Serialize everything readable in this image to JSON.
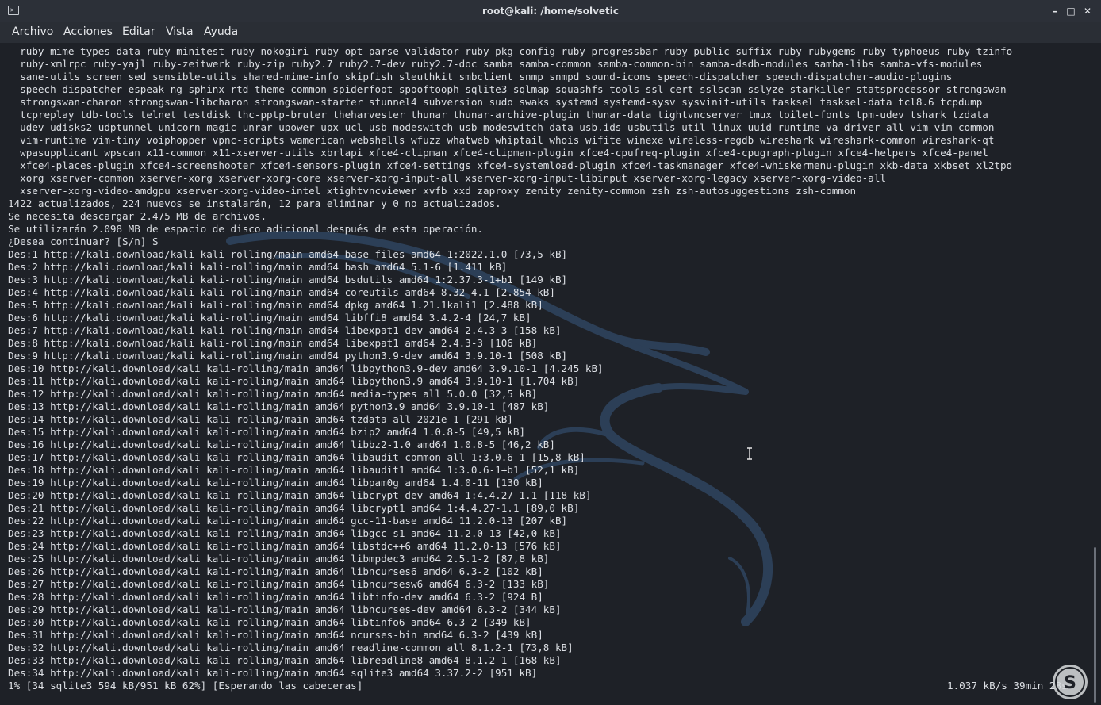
{
  "window": {
    "title": "root@kali: /home/solvetic",
    "icon": "terminal-icon",
    "controls": {
      "minimize": "minimize-icon",
      "maximize": "maximize-icon",
      "close": "close-icon"
    }
  },
  "menubar": {
    "items": [
      "Archivo",
      "Acciones",
      "Editar",
      "Vista",
      "Ayuda"
    ]
  },
  "terminal": {
    "lines": [
      "  ruby-mime-types-data ruby-minitest ruby-nokogiri ruby-opt-parse-validator ruby-pkg-config ruby-progressbar ruby-public-suffix ruby-rubygems ruby-typhoeus ruby-tzinfo",
      "  ruby-xmlrpc ruby-yajl ruby-zeitwerk ruby-zip ruby2.7 ruby2.7-dev ruby2.7-doc samba samba-common samba-common-bin samba-dsdb-modules samba-libs samba-vfs-modules",
      "  sane-utils screen sed sensible-utils shared-mime-info skipfish sleuthkit smbclient snmp snmpd sound-icons speech-dispatcher speech-dispatcher-audio-plugins",
      "  speech-dispatcher-espeak-ng sphinx-rtd-theme-common spiderfoot spooftooph sqlite3 sqlmap squashfs-tools ssl-cert sslscan sslyze starkiller statsprocessor strongswan",
      "  strongswan-charon strongswan-libcharon strongswan-starter stunnel4 subversion sudo swaks systemd systemd-sysv sysvinit-utils tasksel tasksel-data tcl8.6 tcpdump",
      "  tcpreplay tdb-tools telnet testdisk thc-pptp-bruter theharvester thunar thunar-archive-plugin thunar-data tightvncserver tmux toilet-fonts tpm-udev tshark tzdata",
      "  udev udisks2 udptunnel unicorn-magic unrar upower upx-ucl usb-modeswitch usb-modeswitch-data usb.ids usbutils util-linux uuid-runtime va-driver-all vim vim-common",
      "  vim-runtime vim-tiny voiphopper vpnc-scripts wamerican webshells wfuzz whatweb whiptail whois wifite winexe wireless-regdb wireshark wireshark-common wireshark-qt",
      "  wpasupplicant wpscan x11-common x11-xserver-utils xbrlapi xfce4-clipman xfce4-clipman-plugin xfce4-cpufreq-plugin xfce4-cpugraph-plugin xfce4-helpers xfce4-panel",
      "  xfce4-places-plugin xfce4-screenshooter xfce4-sensors-plugin xfce4-settings xfce4-systemload-plugin xfce4-taskmanager xfce4-whiskermenu-plugin xkb-data xkbset xl2tpd",
      "  xorg xserver-common xserver-xorg xserver-xorg-core xserver-xorg-input-all xserver-xorg-input-libinput xserver-xorg-legacy xserver-xorg-video-all",
      "  xserver-xorg-video-amdgpu xserver-xorg-video-intel xtightvncviewer xvfb xxd zaproxy zenity zenity-common zsh zsh-autosuggestions zsh-common",
      "1422 actualizados, 224 nuevos se instalarán, 12 para eliminar y 0 no actualizados.",
      "Se necesita descargar 2.475 MB de archivos.",
      "Se utilizarán 2.098 MB de espacio de disco adicional después de esta operación.",
      "¿Desea continuar? [S/n] S",
      "Des:1 http://kali.download/kali kali-rolling/main amd64 base-files amd64 1:2022.1.0 [73,5 kB]",
      "Des:2 http://kali.download/kali kali-rolling/main amd64 bash amd64 5.1-6 [1.411 kB]",
      "Des:3 http://kali.download/kali kali-rolling/main amd64 bsdutils amd64 1:2.37.3-1+b1 [149 kB]",
      "Des:4 http://kali.download/kali kali-rolling/main amd64 coreutils amd64 8.32-4.1 [2.854 kB]",
      "Des:5 http://kali.download/kali kali-rolling/main amd64 dpkg amd64 1.21.1kali1 [2.488 kB]",
      "Des:6 http://kali.download/kali kali-rolling/main amd64 libffi8 amd64 3.4.2-4 [24,7 kB]",
      "Des:7 http://kali.download/kali kali-rolling/main amd64 libexpat1-dev amd64 2.4.3-3 [158 kB]",
      "Des:8 http://kali.download/kali kali-rolling/main amd64 libexpat1 amd64 2.4.3-3 [106 kB]",
      "Des:9 http://kali.download/kali kali-rolling/main amd64 python3.9-dev amd64 3.9.10-1 [508 kB]",
      "Des:10 http://kali.download/kali kali-rolling/main amd64 libpython3.9-dev amd64 3.9.10-1 [4.245 kB]",
      "Des:11 http://kali.download/kali kali-rolling/main amd64 libpython3.9 amd64 3.9.10-1 [1.704 kB]",
      "Des:12 http://kali.download/kali kali-rolling/main amd64 media-types all 5.0.0 [32,5 kB]",
      "Des:13 http://kali.download/kali kali-rolling/main amd64 python3.9 amd64 3.9.10-1 [487 kB]",
      "Des:14 http://kali.download/kali kali-rolling/main amd64 tzdata all 2021e-1 [291 kB]",
      "Des:15 http://kali.download/kali kali-rolling/main amd64 bzip2 amd64 1.0.8-5 [49,5 kB]",
      "Des:16 http://kali.download/kali kali-rolling/main amd64 libbz2-1.0 amd64 1.0.8-5 [46,2 kB]",
      "Des:17 http://kali.download/kali kali-rolling/main amd64 libaudit-common all 1:3.0.6-1 [15,8 kB]",
      "Des:18 http://kali.download/kali kali-rolling/main amd64 libaudit1 amd64 1:3.0.6-1+b1 [52,1 kB]",
      "Des:19 http://kali.download/kali kali-rolling/main amd64 libpam0g amd64 1.4.0-11 [130 kB]",
      "Des:20 http://kali.download/kali kali-rolling/main amd64 libcrypt-dev amd64 1:4.4.27-1.1 [118 kB]",
      "Des:21 http://kali.download/kali kali-rolling/main amd64 libcrypt1 amd64 1:4.4.27-1.1 [89,0 kB]",
      "Des:22 http://kali.download/kali kali-rolling/main amd64 gcc-11-base amd64 11.2.0-13 [207 kB]",
      "Des:23 http://kali.download/kali kali-rolling/main amd64 libgcc-s1 amd64 11.2.0-13 [42,0 kB]",
      "Des:24 http://kali.download/kali kali-rolling/main amd64 libstdc++6 amd64 11.2.0-13 [576 kB]",
      "Des:25 http://kali.download/kali kali-rolling/main amd64 libmpdec3 amd64 2.5.1-2 [87,8 kB]",
      "Des:26 http://kali.download/kali kali-rolling/main amd64 libncurses6 amd64 6.3-2 [102 kB]",
      "Des:27 http://kali.download/kali kali-rolling/main amd64 libncursesw6 amd64 6.3-2 [133 kB]",
      "Des:28 http://kali.download/kali kali-rolling/main amd64 libtinfo-dev amd64 6.3-2 [924 B]",
      "Des:29 http://kali.download/kali kali-rolling/main amd64 libncurses-dev amd64 6.3-2 [344 kB]",
      "Des:30 http://kali.download/kali kali-rolling/main amd64 libtinfo6 amd64 6.3-2 [349 kB]",
      "Des:31 http://kali.download/kali kali-rolling/main amd64 ncurses-bin amd64 6.3-2 [439 kB]",
      "Des:32 http://kali.download/kali kali-rolling/main amd64 readline-common all 8.1.2-1 [73,8 kB]",
      "Des:33 http://kali.download/kali kali-rolling/main amd64 libreadline8 amd64 8.1.2-1 [168 kB]",
      "Des:34 http://kali.download/kali kali-rolling/main amd64 sqlite3 amd64 3.37.2-2 [951 kB]",
      "1% [34 sqlite3 594 kB/951 kB 62%] [Esperando las cabeceras]"
    ],
    "status_right": "1.037 kB/s 39min 28s",
    "background": "#1e2127",
    "foreground": "#dcdfe4"
  }
}
